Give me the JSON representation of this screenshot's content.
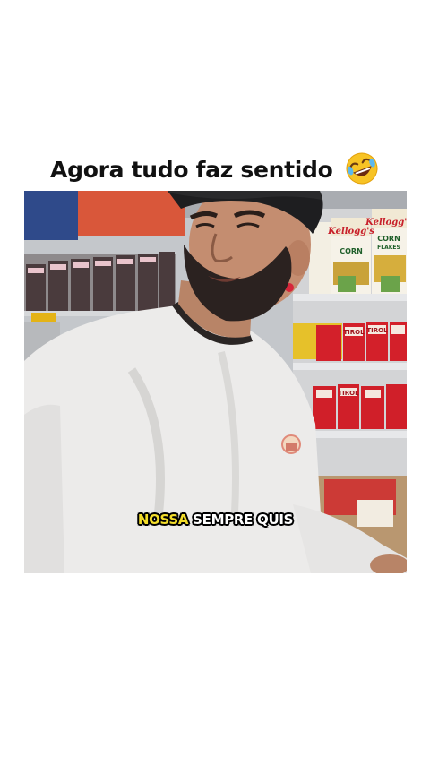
{
  "caption": {
    "text": "Agora tudo faz sentido",
    "emoji": "rolling-on-floor-laughing-emoji"
  },
  "video": {
    "subtitle": {
      "word1": "NOSSA",
      "word2": "SEMPRE",
      "word3": "QUIS",
      "highlight_color": "#f3dd2a"
    },
    "packaging_text": {
      "brand": "Kellogg's",
      "product_line1": "CORN",
      "product_line2": "FLAKES",
      "box_label": "TIROL"
    }
  }
}
